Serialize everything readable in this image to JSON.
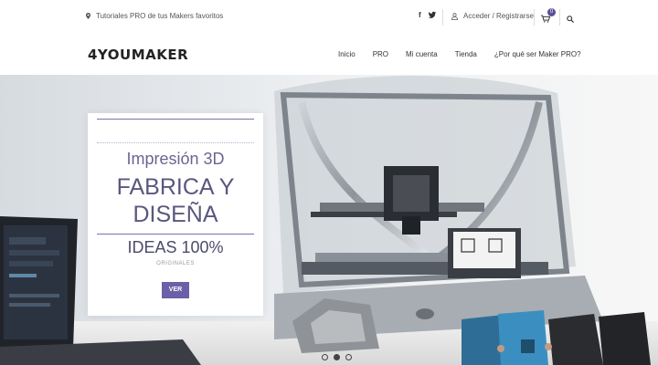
{
  "topbar": {
    "tagline": "Tutoriales PRO de tus Makers favoritos",
    "account": "Acceder / Registrarse",
    "cart_count": "0"
  },
  "nav": {
    "logo": "4YOUMAKER",
    "items": [
      "Inicio",
      "PRO",
      "Mi cuenta",
      "Tienda",
      "¿Por qué ser Maker PRO?"
    ]
  },
  "hero": {
    "subtitle": "Impresión 3D",
    "title_line1": "FABRICA Y",
    "title_line2": "DISEÑA",
    "ideas": "IDEAS 100%",
    "originals": "ORIGINALES",
    "cta": "VER"
  },
  "colors": {
    "accent": "#6b5fa8",
    "text": "#333333",
    "card_bg": "#ffffff"
  },
  "icons": [
    "map-pin-icon",
    "facebook-icon",
    "twitter-icon",
    "user-icon",
    "cart-icon",
    "search-icon"
  ]
}
